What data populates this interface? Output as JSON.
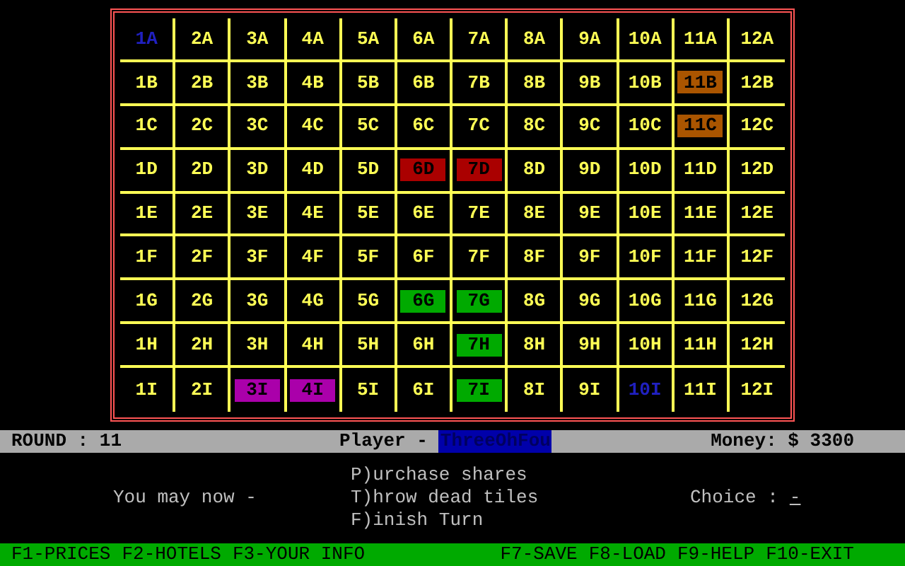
{
  "board": {
    "rows": [
      [
        {
          "label": "1A",
          "kind": "held"
        },
        {
          "label": "2A",
          "kind": "empty"
        },
        {
          "label": "3A",
          "kind": "empty"
        },
        {
          "label": "4A",
          "kind": "empty"
        },
        {
          "label": "5A",
          "kind": "empty"
        },
        {
          "label": "6A",
          "kind": "empty"
        },
        {
          "label": "7A",
          "kind": "empty"
        },
        {
          "label": "8A",
          "kind": "empty"
        },
        {
          "label": "9A",
          "kind": "empty"
        },
        {
          "label": "10A",
          "kind": "empty"
        },
        {
          "label": "11A",
          "kind": "empty"
        },
        {
          "label": "12A",
          "kind": "empty"
        }
      ],
      [
        {
          "label": "1B",
          "kind": "empty"
        },
        {
          "label": "2B",
          "kind": "empty"
        },
        {
          "label": "3B",
          "kind": "empty"
        },
        {
          "label": "4B",
          "kind": "empty"
        },
        {
          "label": "5B",
          "kind": "empty"
        },
        {
          "label": "6B",
          "kind": "empty"
        },
        {
          "label": "7B",
          "kind": "empty"
        },
        {
          "label": "8B",
          "kind": "empty"
        },
        {
          "label": "9B",
          "kind": "empty"
        },
        {
          "label": "10B",
          "kind": "empty"
        },
        {
          "label": "11B",
          "kind": "hotel",
          "color": "#aa5500"
        },
        {
          "label": "12B",
          "kind": "empty"
        }
      ],
      [
        {
          "label": "1C",
          "kind": "empty"
        },
        {
          "label": "2C",
          "kind": "empty"
        },
        {
          "label": "3C",
          "kind": "empty"
        },
        {
          "label": "4C",
          "kind": "empty"
        },
        {
          "label": "5C",
          "kind": "empty"
        },
        {
          "label": "6C",
          "kind": "empty"
        },
        {
          "label": "7C",
          "kind": "empty"
        },
        {
          "label": "8C",
          "kind": "empty"
        },
        {
          "label": "9C",
          "kind": "empty"
        },
        {
          "label": "10C",
          "kind": "empty"
        },
        {
          "label": "11C",
          "kind": "hotel",
          "color": "#aa5500"
        },
        {
          "label": "12C",
          "kind": "empty"
        }
      ],
      [
        {
          "label": "1D",
          "kind": "empty"
        },
        {
          "label": "2D",
          "kind": "empty"
        },
        {
          "label": "3D",
          "kind": "empty"
        },
        {
          "label": "4D",
          "kind": "empty"
        },
        {
          "label": "5D",
          "kind": "empty"
        },
        {
          "label": "6D",
          "kind": "hotel",
          "color": "#aa0000"
        },
        {
          "label": "7D",
          "kind": "hotel",
          "color": "#aa0000"
        },
        {
          "label": "8D",
          "kind": "empty"
        },
        {
          "label": "9D",
          "kind": "empty"
        },
        {
          "label": "10D",
          "kind": "empty"
        },
        {
          "label": "11D",
          "kind": "empty"
        },
        {
          "label": "12D",
          "kind": "empty"
        }
      ],
      [
        {
          "label": "1E",
          "kind": "empty"
        },
        {
          "label": "2E",
          "kind": "empty"
        },
        {
          "label": "3E",
          "kind": "empty"
        },
        {
          "label": "4E",
          "kind": "empty"
        },
        {
          "label": "5E",
          "kind": "empty"
        },
        {
          "label": "6E",
          "kind": "empty"
        },
        {
          "label": "7E",
          "kind": "empty"
        },
        {
          "label": "8E",
          "kind": "empty"
        },
        {
          "label": "9E",
          "kind": "empty"
        },
        {
          "label": "10E",
          "kind": "empty"
        },
        {
          "label": "11E",
          "kind": "empty"
        },
        {
          "label": "12E",
          "kind": "empty"
        }
      ],
      [
        {
          "label": "1F",
          "kind": "empty"
        },
        {
          "label": "2F",
          "kind": "empty"
        },
        {
          "label": "3F",
          "kind": "empty"
        },
        {
          "label": "4F",
          "kind": "empty"
        },
        {
          "label": "5F",
          "kind": "empty"
        },
        {
          "label": "6F",
          "kind": "empty"
        },
        {
          "label": "7F",
          "kind": "empty"
        },
        {
          "label": "8F",
          "kind": "empty"
        },
        {
          "label": "9F",
          "kind": "empty"
        },
        {
          "label": "10F",
          "kind": "empty"
        },
        {
          "label": "11F",
          "kind": "empty"
        },
        {
          "label": "12F",
          "kind": "empty"
        }
      ],
      [
        {
          "label": "1G",
          "kind": "empty"
        },
        {
          "label": "2G",
          "kind": "empty"
        },
        {
          "label": "3G",
          "kind": "empty"
        },
        {
          "label": "4G",
          "kind": "empty"
        },
        {
          "label": "5G",
          "kind": "empty"
        },
        {
          "label": "6G",
          "kind": "hotel",
          "color": "#00aa00"
        },
        {
          "label": "7G",
          "kind": "hotel",
          "color": "#00aa00"
        },
        {
          "label": "8G",
          "kind": "empty"
        },
        {
          "label": "9G",
          "kind": "empty"
        },
        {
          "label": "10G",
          "kind": "empty"
        },
        {
          "label": "11G",
          "kind": "empty"
        },
        {
          "label": "12G",
          "kind": "empty"
        }
      ],
      [
        {
          "label": "1H",
          "kind": "empty"
        },
        {
          "label": "2H",
          "kind": "empty"
        },
        {
          "label": "3H",
          "kind": "empty"
        },
        {
          "label": "4H",
          "kind": "empty"
        },
        {
          "label": "5H",
          "kind": "empty"
        },
        {
          "label": "6H",
          "kind": "empty"
        },
        {
          "label": "7H",
          "kind": "hotel",
          "color": "#00aa00"
        },
        {
          "label": "8H",
          "kind": "empty"
        },
        {
          "label": "9H",
          "kind": "empty"
        },
        {
          "label": "10H",
          "kind": "empty"
        },
        {
          "label": "11H",
          "kind": "empty"
        },
        {
          "label": "12H",
          "kind": "empty"
        }
      ],
      [
        {
          "label": "1I",
          "kind": "empty"
        },
        {
          "label": "2I",
          "kind": "empty"
        },
        {
          "label": "3I",
          "kind": "hotel",
          "color": "#aa00aa"
        },
        {
          "label": "4I",
          "kind": "hotel",
          "color": "#aa00aa"
        },
        {
          "label": "5I",
          "kind": "empty"
        },
        {
          "label": "6I",
          "kind": "empty"
        },
        {
          "label": "7I",
          "kind": "hotel",
          "color": "#00aa00"
        },
        {
          "label": "8I",
          "kind": "empty"
        },
        {
          "label": "9I",
          "kind": "empty"
        },
        {
          "label": "10I",
          "kind": "held"
        },
        {
          "label": "11I",
          "kind": "empty"
        },
        {
          "label": "12I",
          "kind": "empty"
        }
      ]
    ]
  },
  "status_bar": {
    "round": "ROUND : 11",
    "player_label": "Player -",
    "player_name": "ThreeOhFou",
    "money": "Money: $ 3300"
  },
  "prompt": {
    "label": "You may now -",
    "options": [
      "P)urchase shares",
      "T)hrow dead tiles",
      "F)inish Turn"
    ],
    "choice_label": "Choice :",
    "choice_value": "-"
  },
  "function_keys": {
    "left": [
      "F1-PRICES",
      "F2-HOTELS",
      "F3-YOUR INFO"
    ],
    "right": [
      "F7-SAVE",
      "F8-LOAD",
      "F9-HELP",
      "F10-EXIT"
    ]
  }
}
